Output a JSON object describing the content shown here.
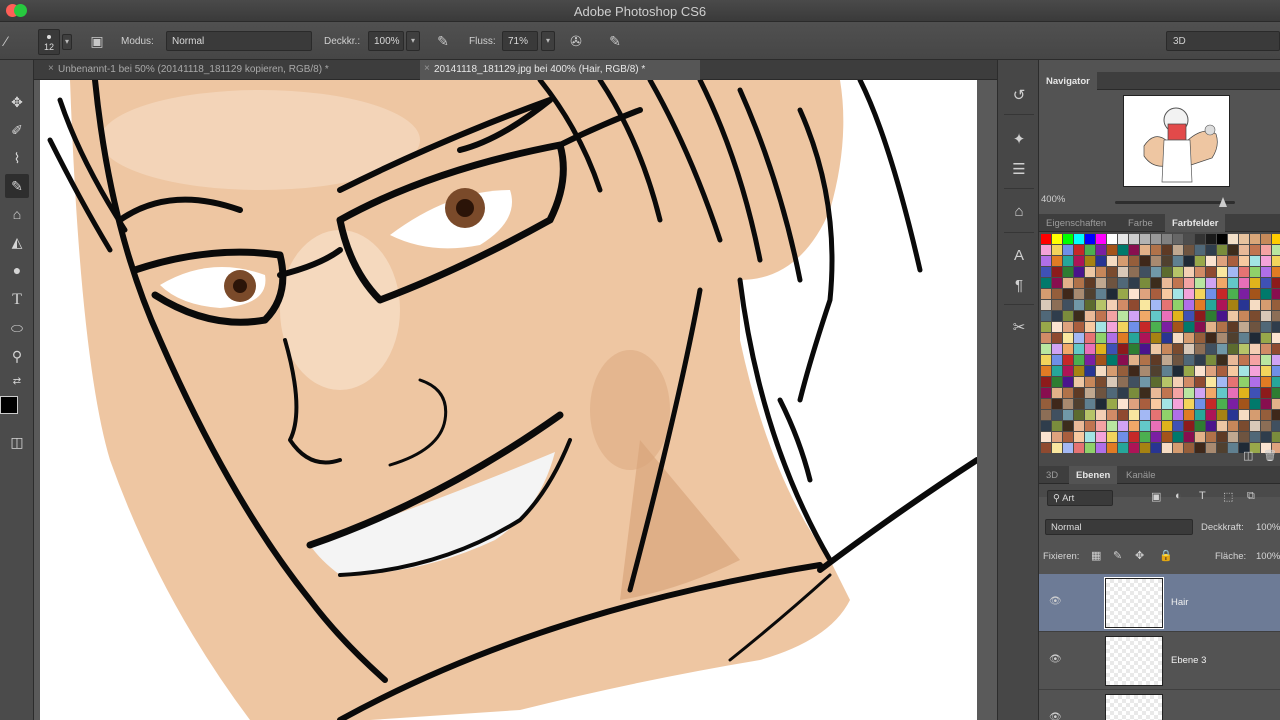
{
  "app": {
    "title": "Adobe Photoshop CS6"
  },
  "options_bar": {
    "brush_size": "12",
    "mode_label": "Modus:",
    "mode_value": "Normal",
    "opacity_label": "Deckkr.:",
    "opacity_value": "100%",
    "flow_label": "Fluss:",
    "flow_value": "71%",
    "workspace": "3D"
  },
  "document_tabs": [
    {
      "label": "Unbenannt-1 bei 50% (20141118_181129 kopieren, RGB/8) *",
      "active": false
    },
    {
      "label": "20141118_181129.jpg bei 400% (Hair, RGB/8) *",
      "active": true
    }
  ],
  "toolbar": {
    "tools": [
      "move-tool",
      "quick-selection-tool",
      "eyedropper-tool",
      "brush-tool",
      "clone-stamp-tool",
      "paint-bucket-tool",
      "dodge-tool",
      "type-tool",
      "ellipse-tool",
      "zoom-tool"
    ],
    "active_tool": "brush-tool",
    "foreground_color": "#000000"
  },
  "navigator": {
    "tab": "Navigator",
    "zoom": "400%"
  },
  "swatches_panel": {
    "tabs": [
      "Eigenschaften",
      "Farbe",
      "Farbfelder"
    ],
    "active_tab": "Farbfelder",
    "top_row": [
      "#ff0000",
      "#ffff00",
      "#00ff00",
      "#00ffff",
      "#0000ff",
      "#ff00ff",
      "#ffffff",
      "#e6e6e6",
      "#cccccc",
      "#b3b3b3",
      "#999999",
      "#808080",
      "#666666",
      "#4d4d4d",
      "#333333",
      "#1a1a1a",
      "#000000",
      "#f2e0c9",
      "#e8c39e",
      "#d9a679",
      "#c68a5a",
      "#ffcc00",
      "#ff9900",
      "#cc3300"
    ],
    "palette_colors": [
      "#f4a3a3",
      "#f7c9a0",
      "#f9e79f",
      "#b9e6a0",
      "#a3e4e4",
      "#a3b8f4",
      "#d0a3f4",
      "#f4a3d9",
      "#e57373",
      "#f0a868",
      "#f2d45c",
      "#8fd16a",
      "#63c8c8",
      "#6f8fe8",
      "#b06fe8",
      "#e86fb8",
      "#c62828",
      "#e07b24",
      "#e0b31c",
      "#4caf50",
      "#26a69a",
      "#3f51b5",
      "#7b1fa2",
      "#ad1457",
      "#8d1b1b",
      "#a4541a",
      "#a68212",
      "#2e7d32",
      "#00796b",
      "#283593",
      "#4a148c",
      "#880e4f",
      "#f5dcc3",
      "#edc7a4",
      "#e2b189",
      "#d59c70",
      "#c7875a",
      "#b07249",
      "#955e3b",
      "#7a4b2f",
      "#5e3a25",
      "#3f281a",
      "#d8c8b8",
      "#c0a890",
      "#a88a70",
      "#8c6e56",
      "#6e5440",
      "#50402f",
      "#405060",
      "#506878",
      "#608090",
      "#7098a8",
      "#2f3d4c",
      "#1f2a36",
      "#5c6b2f",
      "#7a8c3c",
      "#98a84a",
      "#b6c468",
      "#3c2c1c",
      "#fbe3d0",
      "#f3cfb4",
      "#e9b998",
      "#dea27e",
      "#d18b66",
      "#c07450",
      "#a95e3e",
      "#8f4a30"
    ],
    "selected_swatch": "#c62828"
  },
  "layers_panel": {
    "tabs": [
      "3D",
      "Ebenen",
      "Kanäle"
    ],
    "active_tab": "Ebenen",
    "filter_label": "Art",
    "blend_mode": "Normal",
    "opacity_label": "Deckkraft:",
    "opacity_value": "100%",
    "lock_label": "Fixieren:",
    "fill_label": "Fläche:",
    "fill_value": "100%",
    "layers": [
      {
        "name": "Hair",
        "selected": true,
        "visible": true
      },
      {
        "name": "Ebene 3",
        "selected": false,
        "visible": true
      },
      {
        "name": "",
        "selected": false,
        "visible": true
      }
    ]
  },
  "colors": {
    "skin": "#eec6a2",
    "skin_shadow": "#d9a57c",
    "skin_light": "#f6ddc6",
    "iris": "#7a4a2a",
    "lines": "#0a0a0a",
    "selected_layer": "#6d7b96"
  }
}
